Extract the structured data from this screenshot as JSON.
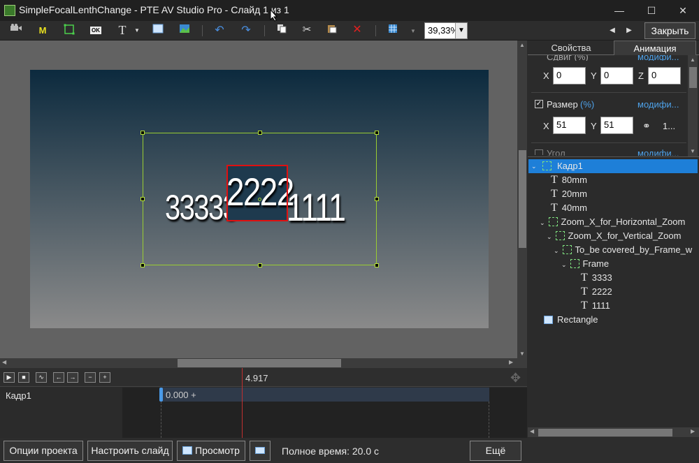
{
  "window": {
    "title": "SimpleFocalLenthChange - PTE AV Studio Pro - Слайд 1 из 1",
    "minimize": "—",
    "maximize": "☐",
    "close": "✕"
  },
  "toolbar": {
    "icons": [
      "camera-icon",
      "mask-icon",
      "frame-icon",
      "ok-icon",
      "text-icon",
      "rectangle-icon",
      "image-icon",
      "undo-icon",
      "redo-icon",
      "copy-icon",
      "cut-icon",
      "paste-icon",
      "delete-icon",
      "grid-icon"
    ],
    "mask_label": "M",
    "text_label": "T",
    "ok_label": "OK",
    "zoom_value": "39,33%",
    "nav_prev": "◀",
    "nav_next": "▶",
    "close_label": "Закрыть"
  },
  "slide": {
    "text_3333": "33333",
    "text_2222": "2222",
    "text_1111": "1111"
  },
  "panel": {
    "tabs": [
      "Свойства",
      "Анимация"
    ],
    "active_tab": "Анимация",
    "offset_label": "Сдвиг (%)",
    "offset_link": "модифи...",
    "offset": {
      "x_label": "X",
      "x": "0",
      "y_label": "Y",
      "y": "0",
      "z_label": "Z",
      "z": "0"
    },
    "size_label": "Размер",
    "size_unit": "(%)",
    "size_link": "модифи...",
    "size": {
      "x_label": "X",
      "x": "51",
      "y_label": "Y",
      "y": "51",
      "ratio": "1..."
    },
    "angle_label": "Угол",
    "angle_link": "модифи..."
  },
  "tree": [
    {
      "label": "Кадр1",
      "type": "frame",
      "expanded": true,
      "selected": true
    },
    {
      "label": "80mm",
      "type": "text"
    },
    {
      "label": "20mm",
      "type": "text"
    },
    {
      "label": "40mm",
      "type": "text"
    },
    {
      "label": "Zoom_X_for_Horizontal_Zoom",
      "type": "frame",
      "expanded": true
    },
    {
      "label": "Zoom_X_for_Vertical_Zoom",
      "type": "frame",
      "expanded": true
    },
    {
      "label": "To_be covered_by_Frame_w",
      "type": "frame",
      "expanded": true
    },
    {
      "label": "Frame",
      "type": "frame",
      "expanded": true
    },
    {
      "label": "3333",
      "type": "text"
    },
    {
      "label": "2222",
      "type": "text"
    },
    {
      "label": "1111",
      "type": "text"
    },
    {
      "label": "Rectangle",
      "type": "rectangle"
    }
  ],
  "timeline": {
    "current_time": "4.917",
    "track_name": "Кадр1",
    "keyframe": "0.000 +",
    "buttons": [
      "▶",
      "■",
      "∿",
      "←",
      "→",
      "−",
      "+"
    ]
  },
  "status": {
    "project_options": "Опции проекта",
    "slide_options": "Настроить слайд",
    "preview": "Просмотр",
    "total_time": "Полное время: 20.0 с",
    "more": "Ещё"
  },
  "colors": {
    "accent": "#1e90ff",
    "selection_red": "#e01010",
    "frame_green": "#9acd32",
    "link_blue": "#4ea1e8"
  }
}
